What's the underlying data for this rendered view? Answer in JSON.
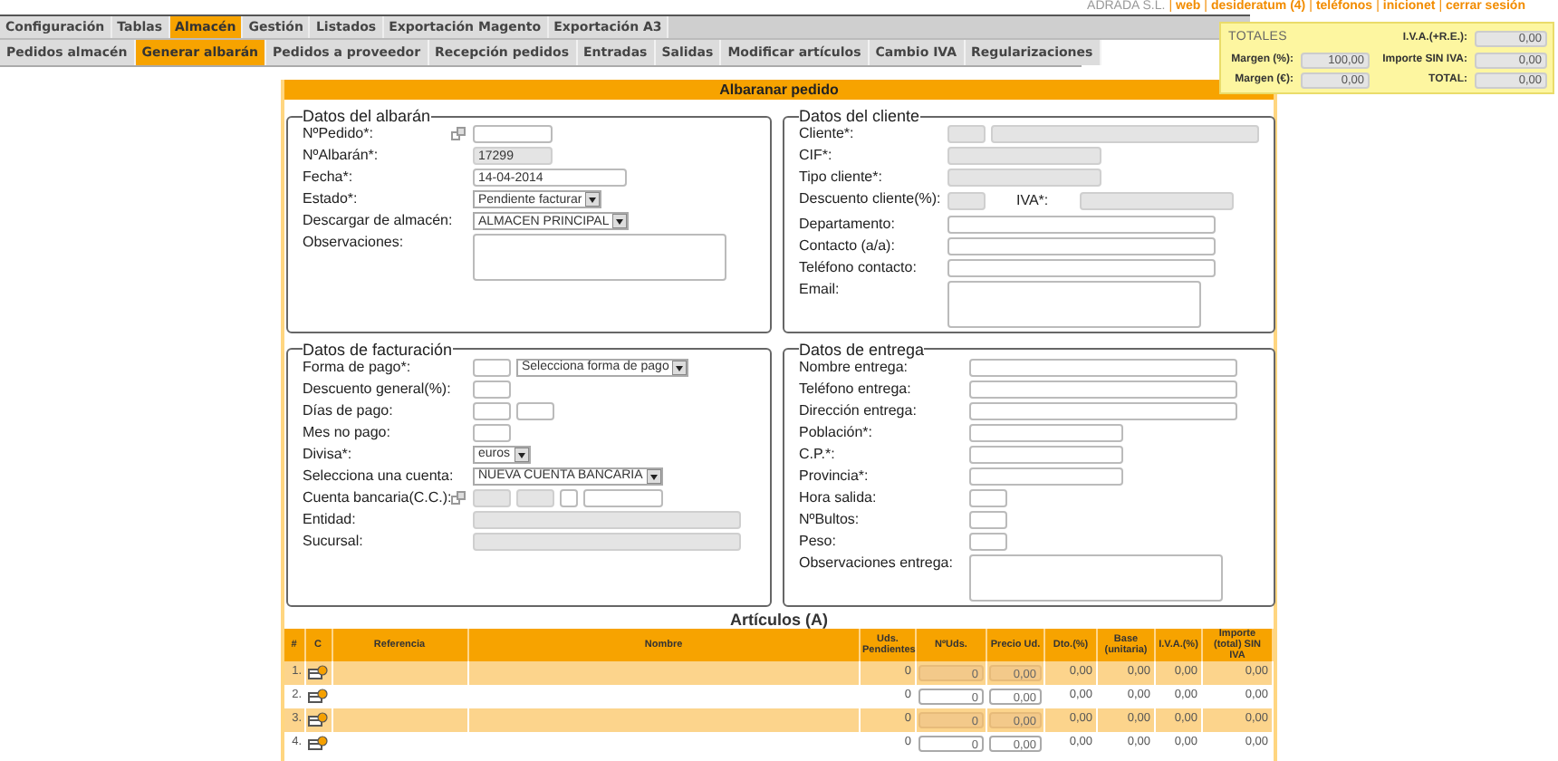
{
  "top_menu": [
    {
      "label": "Configuración",
      "selected": false
    },
    {
      "label": "Tablas",
      "selected": false
    },
    {
      "label": "Almacén",
      "selected": true
    },
    {
      "label": "Gestión",
      "selected": false
    },
    {
      "label": "Listados",
      "selected": false
    },
    {
      "label": "Exportación Magento",
      "selected": false
    },
    {
      "label": "Exportación A3",
      "selected": false
    }
  ],
  "sub_menu": [
    {
      "label": "Pedidos almacén",
      "selected": false
    },
    {
      "label": "Generar albarán",
      "selected": true
    },
    {
      "label": "Pedidos a proveedor",
      "selected": false
    },
    {
      "label": "Recepción pedidos",
      "selected": false
    },
    {
      "label": "Entradas",
      "selected": false
    },
    {
      "label": "Salidas",
      "selected": false
    },
    {
      "label": "Modificar artículos",
      "selected": false
    },
    {
      "label": "Cambio IVA",
      "selected": false
    },
    {
      "label": "Regularizaciones",
      "selected": false
    }
  ],
  "header": {
    "company": "ADRADA S.L.",
    "separator": "|",
    "links": [
      "web",
      "desideratum (4)",
      "teléfonos",
      "inicionet",
      "cerrar sesión"
    ]
  },
  "totals": {
    "title": "TOTALES",
    "left": [
      {
        "label": "Margen (%):",
        "value": "100,00"
      },
      {
        "label": "Margen (€):",
        "value": "0,00"
      }
    ],
    "right": [
      {
        "label": "I.V.A.(+R.E.):",
        "value": "0,00"
      },
      {
        "label": "Importe SIN IVA:",
        "value": "0,00"
      },
      {
        "label": "TOTAL:",
        "value": "0,00"
      }
    ]
  },
  "page_title": "Albaranar pedido",
  "sections": [
    {
      "title": "Datos del albarán",
      "fields": [
        {
          "label": "NºPedido*:",
          "link_icon": true,
          "controls": [
            {
              "kind": "short_input",
              "disabled": false
            }
          ]
        },
        {
          "label": "NºAlbarán*:",
          "link_icon": false,
          "controls": [
            {
              "kind": "short_input",
              "value": "17299",
              "disabled": true
            }
          ]
        },
        {
          "label": "Fecha*:",
          "link_icon": false,
          "controls": [
            {
              "kind": "medium_input",
              "value": "14-04-2014",
              "disabled": false
            }
          ]
        },
        {
          "label": "Estado*:",
          "link_icon": false,
          "controls": [
            {
              "kind": "select",
              "value": "Pendiente facturar"
            }
          ]
        },
        {
          "label": "Descargar de almacén:",
          "link_icon": false,
          "controls": [
            {
              "kind": "select",
              "value": "ALMACEN PRINCIPAL"
            }
          ]
        },
        {
          "label": "Observaciones:",
          "link_icon": false,
          "controls": [
            {
              "kind": "textarea"
            }
          ]
        }
      ]
    },
    {
      "title": "Datos del cliente",
      "fields": [
        {
          "label": "Cliente*:",
          "link_icon": false,
          "controls": [
            {
              "kind": "small_input",
              "disabled": true
            },
            {
              "kind": "long_input",
              "disabled": true
            }
          ]
        },
        {
          "label": "CIF*:",
          "link_icon": false,
          "controls": [
            {
              "kind": "medium_input",
              "disabled": true
            }
          ]
        },
        {
          "label": "Tipo cliente*:",
          "link_icon": false,
          "controls": [
            {
              "kind": "medium_input",
              "disabled": true
            }
          ]
        },
        {
          "label": "Descuento cliente(%):",
          "link_icon": false,
          "controls": [
            {
              "kind": "small_input",
              "disabled": true
            },
            {
              "kind": "label",
              "value": "IVA*:"
            },
            {
              "kind": "medium_input",
              "disabled": true
            }
          ]
        },
        {
          "label": "Departamento:",
          "link_icon": false,
          "controls": [
            {
              "kind": "long_input",
              "disabled": false
            }
          ]
        },
        {
          "label": "Contacto (a/a):",
          "link_icon": false,
          "controls": [
            {
              "kind": "long_input",
              "disabled": false
            }
          ]
        },
        {
          "label": "Teléfono contacto:",
          "link_icon": false,
          "controls": [
            {
              "kind": "long_input",
              "disabled": false
            }
          ]
        },
        {
          "label": "Email:",
          "link_icon": false,
          "controls": [
            {
              "kind": "textarea"
            }
          ]
        }
      ]
    },
    {
      "title": "Datos de facturación",
      "fields": [
        {
          "label": "Forma de pago*:",
          "link_icon": false,
          "controls": [
            {
              "kind": "small_input",
              "disabled": false
            },
            {
              "kind": "select",
              "value": "Selecciona forma de pago"
            }
          ]
        },
        {
          "label": "Descuento general(%):",
          "link_icon": false,
          "controls": [
            {
              "kind": "small_input",
              "disabled": false
            }
          ]
        },
        {
          "label": "Días de pago:",
          "link_icon": false,
          "controls": [
            {
              "kind": "small_input",
              "disabled": false
            },
            {
              "kind": "small_input",
              "disabled": false
            }
          ]
        },
        {
          "label": "Mes no pago:",
          "link_icon": false,
          "controls": [
            {
              "kind": "small_input",
              "disabled": false
            }
          ]
        },
        {
          "label": "Divisa*:",
          "link_icon": false,
          "controls": [
            {
              "kind": "select",
              "value": "euros"
            }
          ]
        },
        {
          "label": "Selecciona una cuenta:",
          "link_icon": false,
          "controls": [
            {
              "kind": "select",
              "value": "NUEVA CUENTA BANCARIA"
            }
          ]
        },
        {
          "label": "Cuenta bancaria(C.C.):",
          "link_icon": true,
          "controls": [
            {
              "kind": "small_input",
              "disabled": true
            },
            {
              "kind": "small_input",
              "disabled": true
            },
            {
              "kind": "tiny_input",
              "disabled": false
            },
            {
              "kind": "short_input",
              "disabled": false
            }
          ]
        },
        {
          "label": "Entidad:",
          "link_icon": false,
          "controls": [
            {
              "kind": "long_input",
              "disabled": true
            }
          ]
        },
        {
          "label": "Sucursal:",
          "link_icon": false,
          "controls": [
            {
              "kind": "long_input",
              "disabled": true
            }
          ]
        }
      ]
    },
    {
      "title": "Datos de entrega",
      "fields": [
        {
          "label": "Nombre entrega:",
          "link_icon": false,
          "controls": [
            {
              "kind": "long_input",
              "disabled": false
            }
          ]
        },
        {
          "label": "Teléfono entrega:",
          "link_icon": false,
          "controls": [
            {
              "kind": "long_input",
              "disabled": false
            }
          ]
        },
        {
          "label": "Dirección entrega:",
          "link_icon": false,
          "controls": [
            {
              "kind": "long_input",
              "disabled": false
            }
          ]
        },
        {
          "label": "Población*:",
          "link_icon": false,
          "controls": [
            {
              "kind": "medium_input",
              "disabled": false
            }
          ]
        },
        {
          "label": "C.P.*:",
          "link_icon": false,
          "controls": [
            {
              "kind": "medium_input",
              "disabled": false
            }
          ]
        },
        {
          "label": "Provincia*:",
          "link_icon": false,
          "controls": [
            {
              "kind": "medium_input",
              "disabled": false
            }
          ]
        },
        {
          "label": "Hora salida:",
          "link_icon": false,
          "controls": [
            {
              "kind": "small_input",
              "disabled": false
            }
          ]
        },
        {
          "label": "NºBultos:",
          "link_icon": false,
          "controls": [
            {
              "kind": "small_input",
              "disabled": false
            }
          ]
        },
        {
          "label": "Peso:",
          "link_icon": false,
          "controls": [
            {
              "kind": "small_input",
              "disabled": false
            }
          ]
        },
        {
          "label": "Observaciones entrega:",
          "link_icon": false,
          "controls": [
            {
              "kind": "textarea"
            }
          ]
        }
      ]
    }
  ],
  "articles": {
    "title": "Artículos (A)",
    "columns": [
      "#",
      "C",
      "Referencia",
      "Nombre",
      "Uds. Pendientes",
      "NºUds.",
      "Precio Ud.",
      "Dto.(%)",
      "Base (unitaria)",
      "I.V.A.(%)",
      "Importe (total) SIN IVA"
    ],
    "rows": [
      {
        "index": "1.",
        "pending": "0",
        "units": "0",
        "price": "0,00",
        "discount": "0,00",
        "base": "0,00",
        "vat": "0,00",
        "amount": "0,00",
        "disabled": true
      },
      {
        "index": "2.",
        "pending": "0",
        "units": "0",
        "price": "0,00",
        "discount": "0,00",
        "base": "0,00",
        "vat": "0,00",
        "amount": "0,00",
        "disabled": false
      },
      {
        "index": "3.",
        "pending": "0",
        "units": "0",
        "price": "0,00",
        "discount": "0,00",
        "base": "0,00",
        "vat": "0,00",
        "amount": "0,00",
        "disabled": true
      },
      {
        "index": "4.",
        "pending": "0",
        "units": "0",
        "price": "0,00",
        "discount": "0,00",
        "base": "0,00",
        "vat": "0,00",
        "amount": "0,00",
        "disabled": false
      }
    ]
  }
}
